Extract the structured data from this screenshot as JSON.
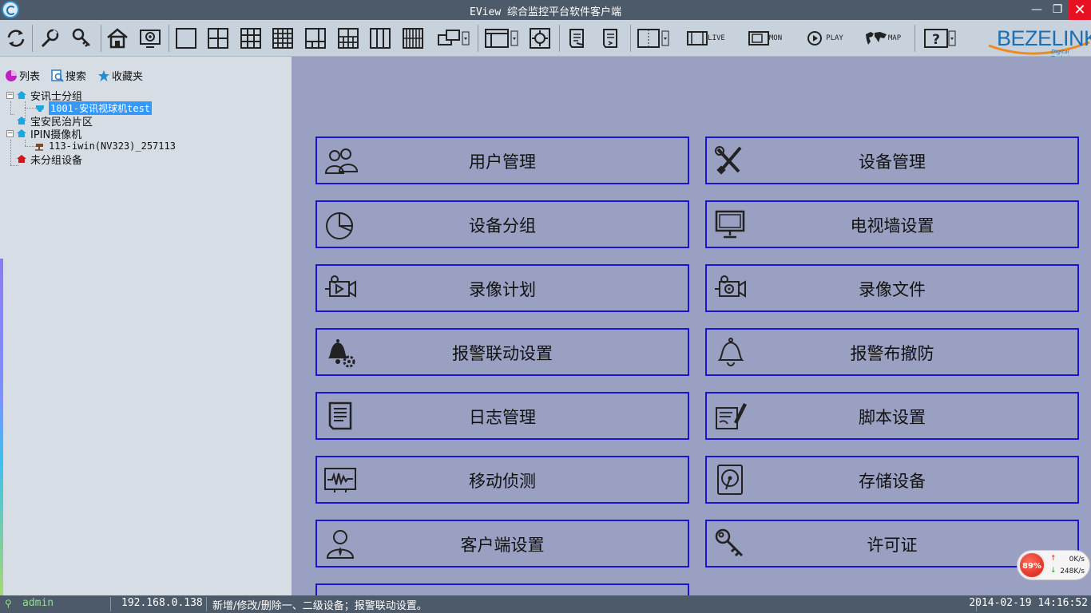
{
  "window": {
    "title": "EView 综合监控平台软件客户端"
  },
  "toolbar": {
    "tags": {
      "live": "LIVE",
      "mon": "MON",
      "play": "PLAY",
      "map": "MAP"
    }
  },
  "brand": {
    "name": "BEZELINK",
    "tagline": "Digital Technic"
  },
  "left": {
    "tabs": [
      {
        "label": "列表",
        "icon": "pie-icon"
      },
      {
        "label": "搜索",
        "icon": "search-doc-icon"
      },
      {
        "label": "收藏夹",
        "icon": "star-icon"
      }
    ],
    "tree": {
      "group1": "安讯士分组",
      "device1": "1001-安讯视球机test",
      "group2": "宝安民治片区",
      "group3": "IPIN摄像机",
      "device2": "113-iwin(NV323)_257113",
      "group4": "未分组设备"
    }
  },
  "cards": [
    {
      "label": "用户管理",
      "icon": "users-icon"
    },
    {
      "label": "设备管理",
      "icon": "tools-icon"
    },
    {
      "label": "设备分组",
      "icon": "pie-chart-icon"
    },
    {
      "label": "电视墙设置",
      "icon": "monitor-icon"
    },
    {
      "label": "录像计划",
      "icon": "camera-plan-icon"
    },
    {
      "label": "录像文件",
      "icon": "camera-file-icon"
    },
    {
      "label": "报警联动设置",
      "icon": "bell-gear-icon"
    },
    {
      "label": "报警布撤防",
      "icon": "bell-icon"
    },
    {
      "label": "日志管理",
      "icon": "log-icon"
    },
    {
      "label": "脚本设置",
      "icon": "script-icon"
    },
    {
      "label": "移动侦测",
      "icon": "motion-icon"
    },
    {
      "label": "存储设备",
      "icon": "storage-icon"
    },
    {
      "label": "客户端设置",
      "icon": "person-icon"
    },
    {
      "label": "许可证",
      "icon": "key-icon"
    }
  ],
  "status": {
    "user": "admin",
    "ip": "192.168.0.138",
    "message": "新增/修改/删除一、二级设备；报警联动设置。",
    "datetime": "2014-02-19 14:16:52"
  },
  "speed": {
    "percent": "89%",
    "up": "0K/s",
    "down": "248K/s"
  },
  "colors": {
    "titlebar": "#4d5a69",
    "main_bg": "#9aa0c1",
    "card_border": "#1b12d4",
    "close": "#e81123",
    "select": "#3399ff"
  }
}
